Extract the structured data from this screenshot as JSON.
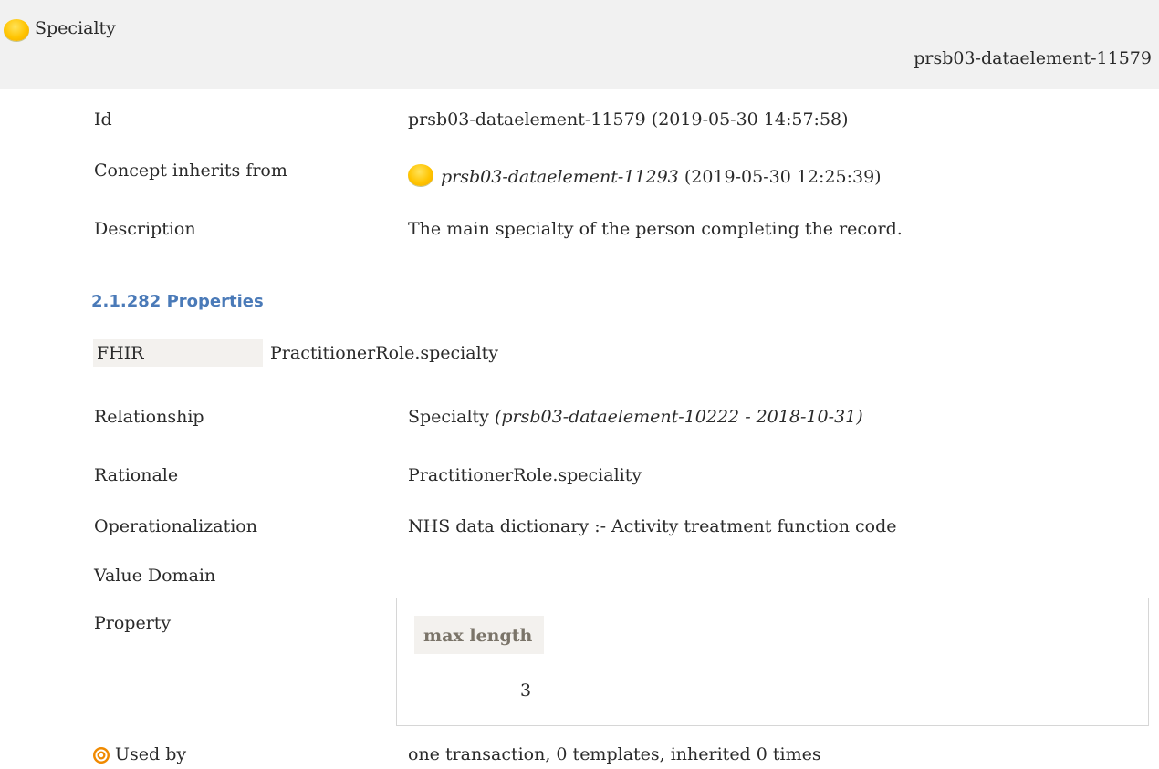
{
  "header": {
    "title": "Specialty",
    "id": "prsb03-dataelement-11579"
  },
  "details": {
    "id_label": "Id",
    "id_value": "prsb03-dataelement-11579 (2019-05-30 14:57:58)",
    "inherits_label": "Concept inherits from",
    "inherits_ref": "prsb03-dataelement-11293",
    "inherits_date": "(2019-05-30 12:25:39)",
    "description_label": "Description",
    "description_value": "The main specialty of the person completing the record."
  },
  "properties": {
    "heading": "2.1.282 Properties",
    "fhir_label": "FHIR",
    "fhir_value": "PractitionerRole.specialty",
    "relationship_label": "Relationship",
    "relationship_name": "Specialty",
    "relationship_ref": "(prsb03-dataelement-10222 - 2018-10-31)",
    "rationale_label": "Rationale",
    "rationale_value": "PractitionerRole.speciality",
    "operationalization_label": "Operationalization",
    "operationalization_value": "NHS data dictionary :- Activity treatment function code",
    "value_domain_label": "Value Domain",
    "property_label": "Property",
    "property_table": {
      "header": "max length",
      "value": "3"
    },
    "used_by_label": "Used by",
    "used_by_value": "one transaction, 0 templates, inherited 0 times"
  },
  "colors": {
    "header_bg": "#f1f1f1",
    "heading_blue": "#4a7ab8",
    "concept_ball": "#ffc400",
    "usage_icon": "#f08a00"
  }
}
